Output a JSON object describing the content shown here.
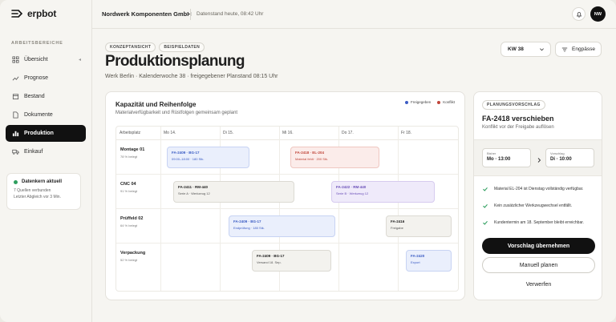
{
  "app": {
    "name": "erpbot",
    "company": "Nordwerk Komponenten GmbH",
    "datestamp": "Datenstand heute, 08:42 Uhr",
    "user_initials": "NW"
  },
  "sidebar": {
    "section": "ARBEITSBEREICHE",
    "items": [
      {
        "label": "Übersicht",
        "icon": "grid-icon"
      },
      {
        "label": "Prognose",
        "icon": "trend-icon"
      },
      {
        "label": "Bestand",
        "icon": "box-icon"
      },
      {
        "label": "Dokumente",
        "icon": "document-icon"
      },
      {
        "label": "Produktion",
        "icon": "bar-chart-icon",
        "active": true
      },
      {
        "label": "Einkauf",
        "icon": "truck-icon"
      }
    ],
    "status": {
      "title": "Datenkern aktuell",
      "line1": "7 Quellen verbunden",
      "line2": "Letzter Abgleich vor 3 Min."
    }
  },
  "page": {
    "tags": [
      "KONZEPTANSICHT",
      "BEISPIELDATEN"
    ],
    "title": "Produktionsplanung",
    "subtitle": "Werk Berlin · Kalenderwoche 38 · freigegebener Planstand 08:15 Uhr",
    "week_select": "KW 38",
    "bottlenecks_button": "Engpässe"
  },
  "capacity": {
    "title": "Kapazität und Reihenfolge",
    "subtitle": "Materialverfügbarkeit und Rüstfolgen gemeinsam geplant",
    "legend": {
      "approved": "Freigegeben",
      "conflict": "Konflikt"
    },
    "columns": [
      "Arbeitsplatz",
      "Mo 14.",
      "Di 15.",
      "Mi 16.",
      "Do 17.",
      "Fr 18."
    ],
    "rows": [
      {
        "name": "Montage 01",
        "util": "78 % belegt"
      },
      {
        "name": "CNC 04",
        "util": "91 % belegt"
      },
      {
        "name": "Prüffeld 02",
        "util": "64 % belegt"
      },
      {
        "name": "Verpackung",
        "util": "52 % belegt"
      }
    ],
    "bars": [
      {
        "title": "FA-2409 · BG-17",
        "sub": "09:00–18:00 · 180 Stk.",
        "style": "blue"
      },
      {
        "title": "FA-2418 · EL-204",
        "sub": "Material fehlt · 200 Stk.",
        "style": "red"
      },
      {
        "title": "FA-2411 · RM-440",
        "sub": "Serie A · Werkzeug 12",
        "style": "grey"
      },
      {
        "title": "FA-2422 · RM-440",
        "sub": "Serie B · Werkzeug 12",
        "style": "purple"
      },
      {
        "title": "FA-2409 · BG-17",
        "sub": "Endprüfung · 180 Stk.",
        "style": "blue"
      },
      {
        "title": "FA-2416",
        "sub": "Freigabe",
        "style": "grey"
      },
      {
        "title": "FA-2409 · BG-17",
        "sub": "Versand 18. Sep.",
        "style": "grey"
      },
      {
        "title": "FA-2420",
        "sub": "Export",
        "style": "blue"
      }
    ]
  },
  "proposal": {
    "tag": "PLANUNGSVORSCHLAG",
    "title": "FA-2418 verschieben",
    "subtitle": "Konflikt vor der Freigabe auflösen",
    "from_label": "Bisher",
    "from_value": "Mo · 13:00",
    "to_label": "Vorschlag",
    "to_value": "Di · 10:00",
    "checks": [
      "Material EL-204 ist Dienstag vollständig verfügbar.",
      "Kein zusätzlicher Werkzeugwechsel entfällt.",
      "Kundentermin am 18. September bleibt erreichbar."
    ],
    "accept": "Vorschlag übernehmen",
    "manual": "Manuell planen",
    "reject": "Verwerfen"
  },
  "colors": {
    "accent": "#111111",
    "approved": "#3b5cc4",
    "conflict": "#c0463a",
    "ok": "#2e9e5e"
  }
}
